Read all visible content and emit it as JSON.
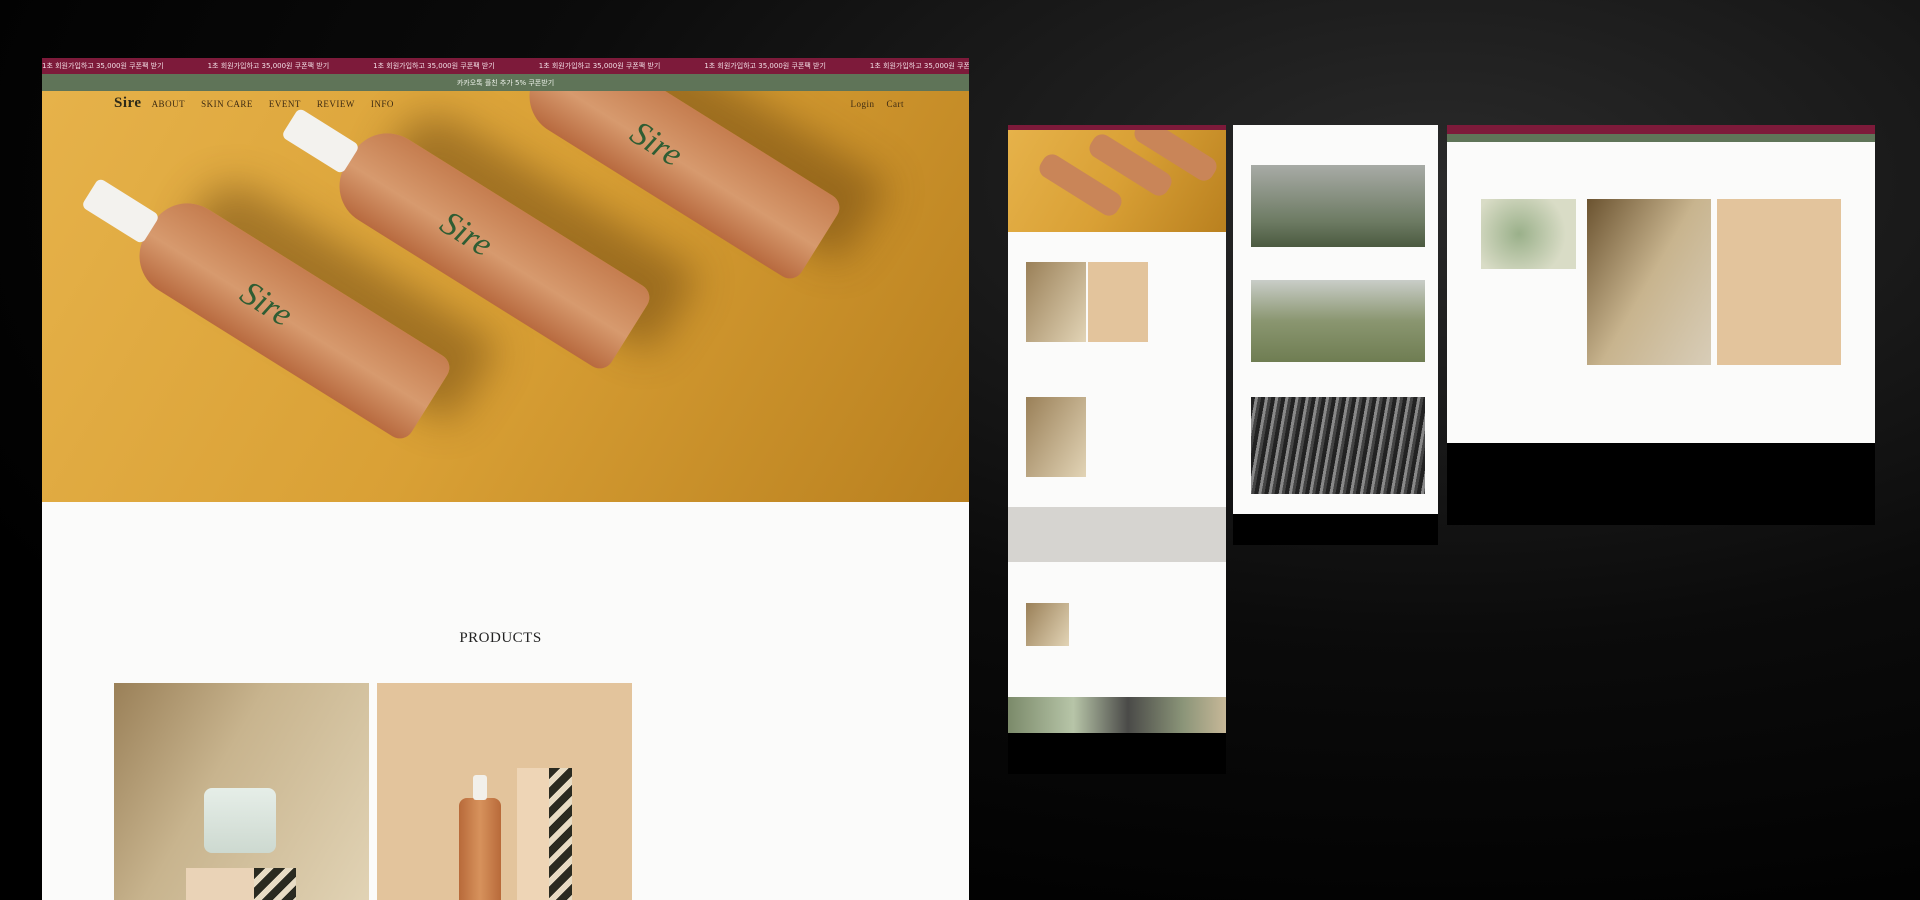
{
  "announcement": {
    "marquee_text": "1초 회원가입하고 35,000원 쿠폰팩 받기",
    "kakao_text": "카카오톡 플친 추가 5% 쿠폰받기"
  },
  "nav": {
    "logo": "Sire",
    "items": [
      "ABOUT",
      "SKIN CARE",
      "EVENT",
      "REVIEW",
      "INFO"
    ],
    "login": "Login",
    "cart": "Cart"
  },
  "main": {
    "section_title": "PRODUCTS",
    "bottle_label": "Sire"
  },
  "colors": {
    "marquee": "#7d1a3a",
    "kakao_bar": "#5f7458",
    "hero": "#d9a035",
    "footer": "#000000"
  }
}
